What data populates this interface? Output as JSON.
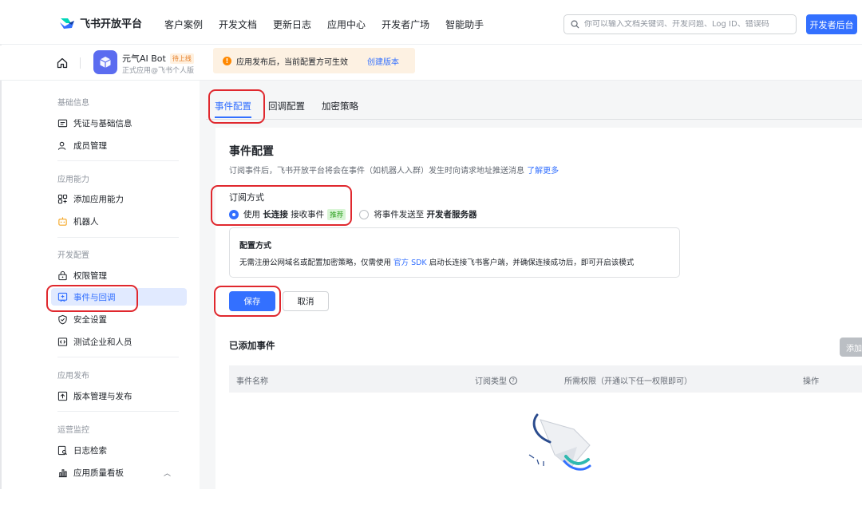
{
  "nav": {
    "brand": "飞书开放平台",
    "items": [
      "客户案例",
      "开发文档",
      "更新日志",
      "应用中心",
      "开发者广场",
      "智能助手"
    ],
    "search_placeholder": "你可以输入文档关键词、开发问题、Log ID、错误码",
    "dev_console": "开发者后台"
  },
  "app": {
    "name": "元气AI Bot",
    "status_tag": "待上线",
    "subtitle": "正式应用@飞书个人版",
    "notice": "应用发布后，当前配置方可生效",
    "notice_link": "创建版本"
  },
  "sidebar": {
    "groups": [
      "基础信息",
      "应用能力",
      "开发配置",
      "应用发布",
      "运营监控"
    ],
    "items": [
      {
        "label": "凭证与基础信息",
        "icon": "credential-icon"
      },
      {
        "label": "成员管理",
        "icon": "member-icon"
      },
      {
        "label": "添加应用能力",
        "icon": "add-capability-icon"
      },
      {
        "label": "机器人",
        "icon": "robot-icon"
      },
      {
        "label": "权限管理",
        "icon": "permission-icon"
      },
      {
        "label": "事件与回调",
        "icon": "event-icon",
        "active": true
      },
      {
        "label": "安全设置",
        "icon": "shield-icon"
      },
      {
        "label": "测试企业和人员",
        "icon": "test-icon"
      },
      {
        "label": "版本管理与发布",
        "icon": "upload-icon"
      },
      {
        "label": "日志检索",
        "icon": "log-search-icon"
      },
      {
        "label": "应用质量看板",
        "icon": "chart-icon"
      }
    ]
  },
  "tabs": [
    "事件配置",
    "回调配置",
    "加密策略"
  ],
  "main": {
    "title": "事件配置",
    "description": "订阅事件后，飞书开放平台将会在事件（如机器人入群）发生时向请求地址推送消息",
    "learn_more": "了解更多",
    "subscription_label": "订阅方式",
    "option1_prefix": "使用",
    "option1_bold": "长连接",
    "option1_suffix": "接收事件",
    "option1_badge": "推荐",
    "option2_prefix": "将事件发送至",
    "option2_bold": "开发者服务器",
    "config_title": "配置方式",
    "config_text_before": "无需注册公网域名或配置加密策略，仅需使用",
    "config_link": "官方 SDK",
    "config_text_after": "启动长连接飞书客户端，并确保连接成功后，即可开启该模式",
    "save": "保存",
    "cancel": "取消",
    "added_title": "已添加事件",
    "add_button": "添加",
    "columns": [
      "事件名称",
      "订阅类型",
      "所需权限（开通以下任一权限即可）",
      "操作"
    ]
  },
  "colors": {
    "accent": "#3370ff",
    "highlight": "#e0282e",
    "active_bg": "#e1eaff"
  }
}
